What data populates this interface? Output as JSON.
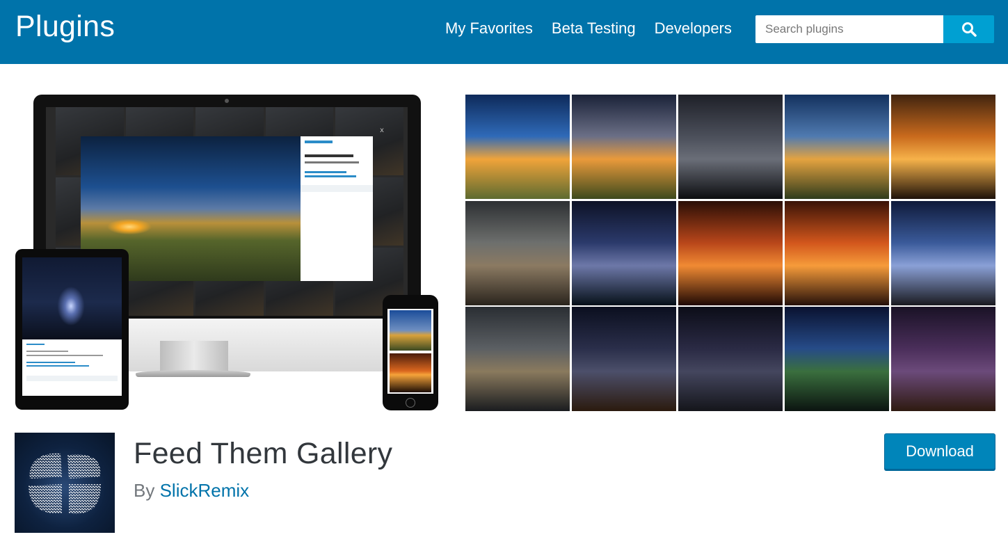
{
  "header": {
    "site_title": "Plugins",
    "nav": [
      {
        "label": "My Favorites"
      },
      {
        "label": "Beta Testing"
      },
      {
        "label": "Developers"
      }
    ],
    "search": {
      "placeholder": "Search plugins",
      "button_icon": "search-icon"
    },
    "background_color": "#0073aa",
    "search_button_color": "#00a0d2"
  },
  "banner": {
    "mockup_lightbox_close": "x",
    "photo_grid": {
      "rows": 3,
      "columns": 5,
      "photos": [
        {
          "name": "sunset-beach-clouds",
          "colors": [
            "#0e2a5a",
            "#2f6ab8",
            "#f0a43a",
            "#5d6b30"
          ]
        },
        {
          "name": "sunflower-field-sunset",
          "colors": [
            "#1a2238",
            "#6b6f86",
            "#e99a3b",
            "#3d4a1d"
          ]
        },
        {
          "name": "milky-way-dead-tree",
          "colors": [
            "#1e2028",
            "#4b4f5a",
            "#6a6e78",
            "#0c0d10"
          ]
        },
        {
          "name": "sunset-shore-foliage",
          "colors": [
            "#13315e",
            "#4f7ab0",
            "#e4a340",
            "#2f3b1c"
          ]
        },
        {
          "name": "pier-posts-sunset",
          "colors": [
            "#41240f",
            "#c96a1d",
            "#f6b24a",
            "#1e120a"
          ]
        },
        {
          "name": "rocky-shore-dusk",
          "colors": [
            "#2d3033",
            "#6d6f6d",
            "#8b7a62",
            "#2a241d"
          ]
        },
        {
          "name": "lightning-storm-night",
          "colors": [
            "#0d1226",
            "#2b3a6b",
            "#6d78a8",
            "#061018"
          ]
        },
        {
          "name": "orange-sky-waves",
          "colors": [
            "#2a0e06",
            "#b8461a",
            "#f08a33",
            "#1e0804"
          ]
        },
        {
          "name": "surfer-silhouette-sunset",
          "colors": [
            "#3a1307",
            "#d2561c",
            "#f69b3a",
            "#25100a"
          ]
        },
        {
          "name": "lightning-bridge",
          "colors": [
            "#0f1a3a",
            "#3a5a9a",
            "#8aa0d6",
            "#1a1a20"
          ]
        },
        {
          "name": "driftwood-beach",
          "colors": [
            "#2a2e33",
            "#5b5f63",
            "#8a7a5e",
            "#1a1c1f"
          ]
        },
        {
          "name": "lighthouse-milky-way",
          "colors": [
            "#0b0f1f",
            "#2a2e4a",
            "#4c4f6a",
            "#2b1a0e"
          ]
        },
        {
          "name": "car-under-stars",
          "colors": [
            "#0c0d18",
            "#2a2a44",
            "#44465e",
            "#14151a"
          ]
        },
        {
          "name": "flashlight-milky-way",
          "colors": [
            "#0a1230",
            "#264b88",
            "#3a6f3e",
            "#0b1410"
          ]
        },
        {
          "name": "lifeguard-tower-night",
          "colors": [
            "#1a1226",
            "#4a2e5a",
            "#6b4a7a",
            "#2e1a10"
          ]
        }
      ]
    }
  },
  "plugin": {
    "name": "Feed Them Gallery",
    "by_prefix": "By",
    "author": "SlickRemix",
    "download_label": "Download",
    "download_color": "#0085ba",
    "icon": "fingerprint-tiles-icon"
  }
}
